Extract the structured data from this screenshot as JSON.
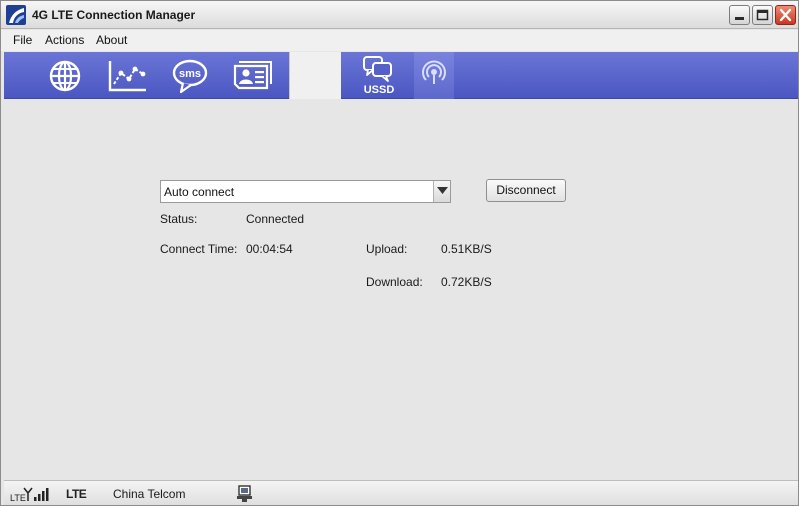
{
  "window": {
    "title": "4G LTE Connection Manager"
  },
  "menu": {
    "file": "File",
    "actions": "Actions",
    "about": "About"
  },
  "toolbar": {
    "buttons": [
      {
        "icon": "globe-icon"
      },
      {
        "icon": "statistics-chart-icon"
      },
      {
        "icon": "sms-icon",
        "label": "sms"
      },
      {
        "icon": "contacts-card-icon"
      },
      {
        "icon": "blank-tab"
      },
      {
        "icon": "ussd-icon",
        "label": "USSD"
      },
      {
        "icon": "broadcast-icon"
      }
    ],
    "colors": {
      "bar": "#5560c9",
      "selected": "#f0f0f0"
    }
  },
  "connection": {
    "mode_selected": "Auto connect",
    "disconnect_label": "Disconnect",
    "status_label": "Status:",
    "status_value": "Connected",
    "connect_time_label": "Connect Time:",
    "connect_time_value": "00:04:54",
    "upload_label": "Upload:",
    "upload_value": "0.51KB/S",
    "download_label": "Download:",
    "download_value": "0.72KB/S"
  },
  "statusbar": {
    "signal_prefix": "LTE",
    "network_type": "LTE",
    "operator": "China Telcom"
  }
}
